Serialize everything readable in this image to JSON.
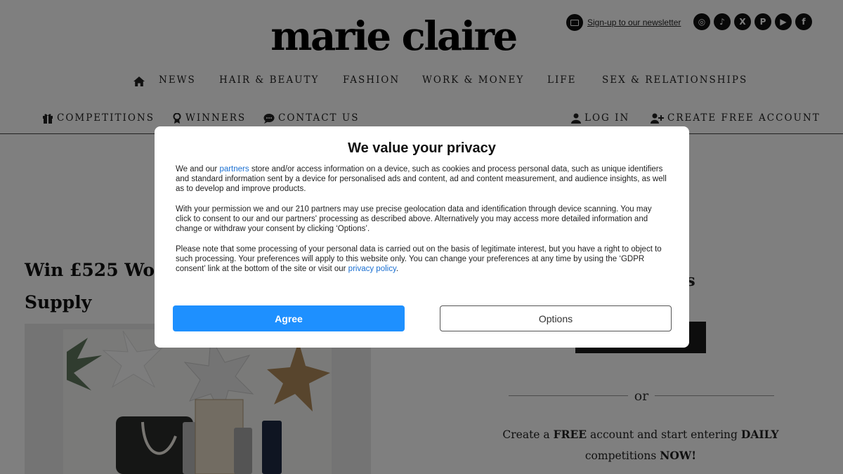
{
  "header": {
    "logo": "marie claire",
    "newsletter_link": "Sign-up to our newsletter",
    "socials": [
      {
        "icon": "instagram-icon",
        "glyph": "◎"
      },
      {
        "icon": "tiktok-icon",
        "glyph": "♪"
      },
      {
        "icon": "x-icon",
        "glyph": "X"
      },
      {
        "icon": "pinterest-icon",
        "glyph": "P"
      },
      {
        "icon": "youtube-icon",
        "glyph": "▶"
      },
      {
        "icon": "facebook-icon",
        "glyph": "f"
      }
    ]
  },
  "main_nav": [
    "NEWS",
    "HAIR & BEAUTY",
    "FASHION",
    "WORK & MONEY",
    "LIFE",
    "SEX & RELATIONSHIPS"
  ],
  "sub_nav": {
    "competitions": "COMPETITIONS",
    "winners": "WINNERS",
    "contact": "CONTACT US",
    "login": "LOG IN",
    "create_account": "CREATE FREE ACCOUNT"
  },
  "article": {
    "title_line1": "Win £525 Wort",
    "title_line2": "Supply"
  },
  "sidebar": {
    "heading_fragment": "ers",
    "or": "or",
    "cta_prefix": "Create a ",
    "cta_free": "FREE",
    "cta_middle": " account and start entering ",
    "cta_daily": "DAILY",
    "cta_end_pre": "competitions ",
    "cta_now": "NOW!"
  },
  "consent": {
    "title": "We value your privacy",
    "p1_pre": "We and our ",
    "p1_link": "partners",
    "p1_post": " store and/or access information on a device, such as cookies and process personal data, such as unique identifiers and standard information sent by a device for personalised ads and content, ad and content measurement, and audience insights, as well as to develop and improve products.",
    "p2": "With your permission we and our 210 partners may use precise geolocation data and identification through device scanning. You may click to consent to our and our partners' processing as described above. Alternatively you may access more detailed information and change or withdraw your consent by clicking ‘Options’.",
    "p3_pre": "Please note that some processing of your personal data is carried out on the basis of legitimate interest, but you have a right to object to such processing. Your preferences will apply to this website only. You can change your preferences at any time by using the ‘GDPR consent’ link at the bottom of the site or visit our ",
    "p3_link": "privacy policy",
    "p3_post": ".",
    "agree_label": "Agree",
    "options_label": "Options"
  },
  "colors": {
    "agree_button": "#1e90ff",
    "link": "#1a6fd1",
    "backdrop": "rgba(0,0,0,0.5)"
  }
}
